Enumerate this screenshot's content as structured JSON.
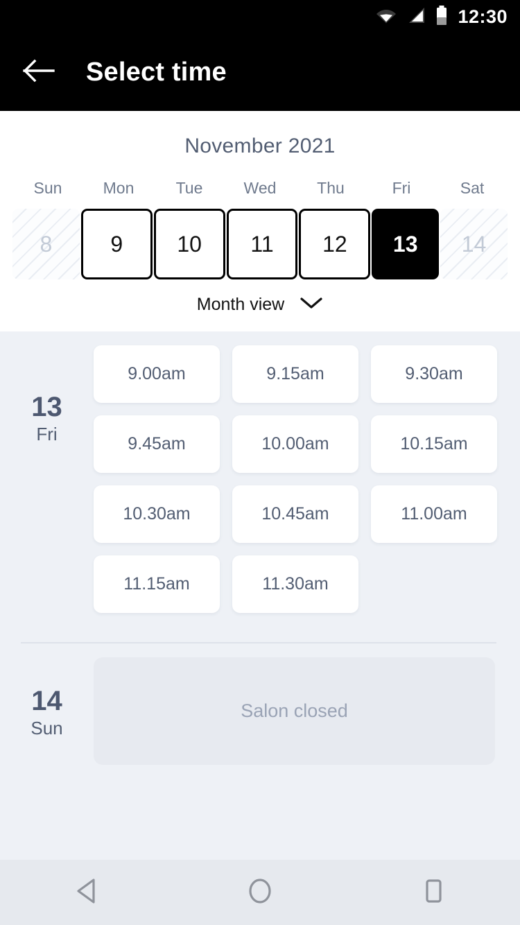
{
  "status_bar": {
    "time": "12:30",
    "icons": [
      "wifi-icon",
      "cell-signal-icon",
      "battery-icon"
    ]
  },
  "app_bar": {
    "back_icon": "back-arrow-icon",
    "title": "Select time"
  },
  "calendar": {
    "month_title": "November 2021",
    "day_headers": [
      "Sun",
      "Mon",
      "Tue",
      "Wed",
      "Thu",
      "Fri",
      "Sat"
    ],
    "dates": [
      {
        "day": "8",
        "state": "disabled"
      },
      {
        "day": "9",
        "state": "normal"
      },
      {
        "day": "10",
        "state": "normal"
      },
      {
        "day": "11",
        "state": "normal"
      },
      {
        "day": "12",
        "state": "normal"
      },
      {
        "day": "13",
        "state": "selected"
      },
      {
        "day": "14",
        "state": "disabled"
      }
    ],
    "view_toggle": {
      "label": "Month view",
      "icon": "chevron-down-icon"
    }
  },
  "schedule": {
    "days": [
      {
        "day_number": "13",
        "day_name": "Fri",
        "slots": [
          "9.00am",
          "9.15am",
          "9.30am",
          "9.45am",
          "10.00am",
          "10.15am",
          "10.30am",
          "10.45am",
          "11.00am",
          "11.15am",
          "11.30am"
        ],
        "closed_message": null
      },
      {
        "day_number": "14",
        "day_name": "Sun",
        "slots": [],
        "closed_message": "Salon closed"
      }
    ]
  },
  "nav_bar": {
    "buttons": [
      {
        "name": "back-nav-button",
        "icon": "triangle-back-icon"
      },
      {
        "name": "home-nav-button",
        "icon": "circle-home-icon"
      },
      {
        "name": "recents-nav-button",
        "icon": "square-recents-icon"
      }
    ]
  },
  "colors": {
    "appbar_bg": "#000000",
    "page_bg": "#eef1f6",
    "card_bg": "#ffffff",
    "text_primary": "#4d5870",
    "text_muted": "#9aa3b5",
    "selected_date_bg": "#000000",
    "closed_card_bg": "#e7eaf0",
    "navbar_bg": "#e6e9ee"
  }
}
